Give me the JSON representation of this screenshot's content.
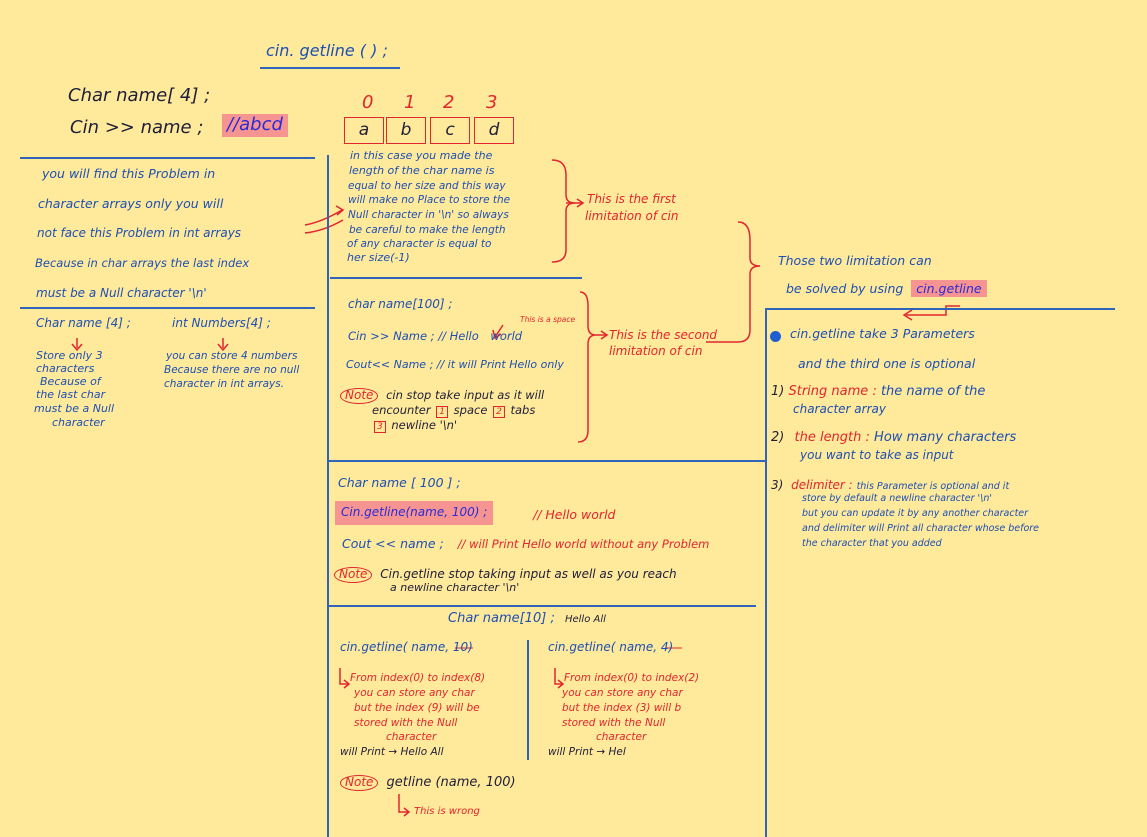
{
  "header": {
    "title": "cin. getline ( ) ;"
  },
  "top": {
    "line1": "Char   name[ 4] ;",
    "line2": "Cin  >>  name ;",
    "comment": "//abcd"
  },
  "array": {
    "indices": [
      "0",
      "1",
      "2",
      "3"
    ],
    "cells": [
      "a",
      "b",
      "c",
      "d"
    ]
  },
  "left": {
    "lines": [
      "you will find  this Problem in",
      "character arrays only  you will",
      "not face this Problem in int arrays",
      "Because in char arrays  the last index",
      "must be  a Null character '\\n'"
    ],
    "decl_char": "Char  name [4] ;",
    "decl_int": "int  Numbers[4] ;",
    "char_note": [
      "Store only 3",
      "characters",
      "Because of",
      "the last char",
      "must be a Null",
      "character"
    ],
    "int_note": [
      "you can store 4 numbers",
      "Because there are no null",
      "character in int arrays."
    ]
  },
  "explain": {
    "lines": [
      "in this case you made the",
      "length of the char name is",
      "equal to her size and this way",
      "will make no Place to store the",
      "Null character in '\\n' so always",
      "be careful to make the length",
      "of any character is equal to",
      "her size(-1)"
    ],
    "first_limit": [
      "This is the first",
      "limitation of cin"
    ]
  },
  "second": {
    "decl": "char  name[100] ;",
    "cin_line": "Cin  >>  Name ;  // Hello",
    "world": "world",
    "space_note": "This is a space",
    "cout_line": "Cout<<  Name ; // it will Print Hello only",
    "note_label": "Note",
    "note_1": "cin stop take input as it will",
    "note_2a": "encounter",
    "note_2b": "space",
    "note_2c": "tabs",
    "note_3": "newline '\\n'",
    "n1": "1",
    "n2": "2",
    "n3": "3",
    "second_limit": [
      "This is the second",
      "limitation of cin"
    ]
  },
  "solution": {
    "line1": "Those two limitation can",
    "line2": "be solved by using",
    "highlight": "cin.getline"
  },
  "params": {
    "line1": "cin.getline take 3 Parameters",
    "line2": "and the third one is optional",
    "p1_num": "1)",
    "p1_name": "String name :",
    "p1_desc": "the name of the",
    "p1_desc2": "character array",
    "p2_num": "2)",
    "p2_name": "the length :",
    "p2_desc": "How many characters",
    "p2_desc2": "you want to take as input",
    "p3_num": "3)",
    "p3_name": "delimiter :",
    "p3_lines": [
      "this Parameter is optional and it",
      "store by default a newline character '\\n'",
      "but you can update it by any another character",
      "and delimiter will Print all character whose before",
      "the character that you added"
    ]
  },
  "example": {
    "decl": "Char  name [ 100 ] ;",
    "call": "Cin.getline(name, 100) ;",
    "comment": "// Hello world",
    "cout": "Cout <<  name ;",
    "cout_comment": "// will Print Hello world without any Problem",
    "note_label": "Note",
    "note_1": "Cin.getline  stop taking input as well as you reach",
    "note_2": "a newline character '\\n'"
  },
  "bottom": {
    "title": "Char  name[10] ;",
    "title_comment": "Hello All",
    "left_call": "cin.getline( name, 10)",
    "left_lines": [
      "From index(0) to index(8)",
      "you can store any char",
      "but the index (9) will be",
      "stored with the Null",
      "character"
    ],
    "left_print": "will Print",
    "left_result": "Hello All",
    "right_call": "cin.getline( name, 4)",
    "right_lines": [
      "From index(0) to index(2)",
      "you can store any char",
      "but the index (3) will b",
      "stored with the Null",
      "character"
    ],
    "right_print": "will Print",
    "right_result": "Hel",
    "note_label": "Note",
    "note_code": "getline (name, 100)",
    "wrong": "This is wrong"
  },
  "colors": {
    "background": "#FFE99A",
    "ink_blue": "#1d4fb5",
    "ink_red": "#e2262f",
    "highlight": "#F59490",
    "rule": "#2f64b8"
  }
}
